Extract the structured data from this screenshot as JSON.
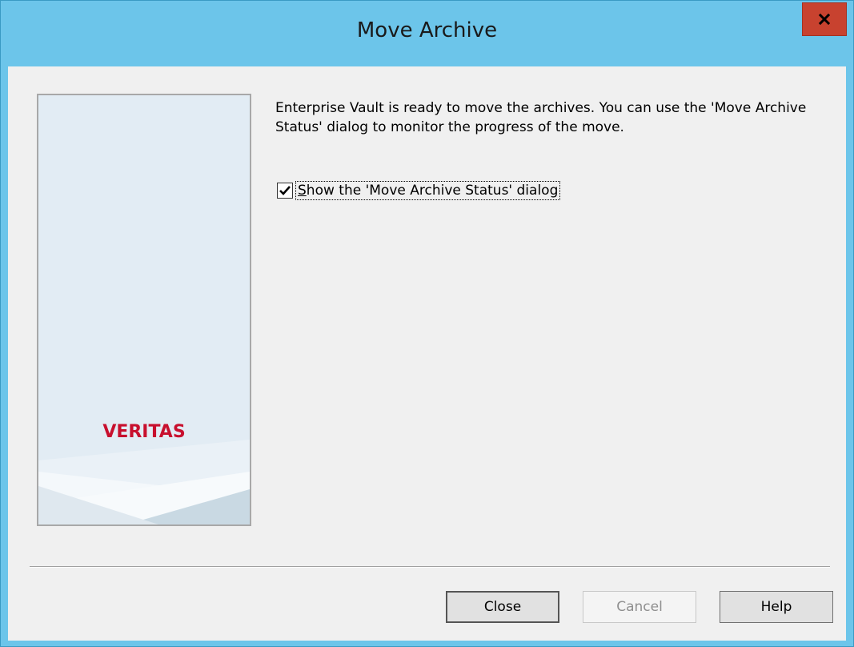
{
  "window": {
    "title": "Move Archive",
    "close_glyph": "x"
  },
  "banner": {
    "logo_text": "VERITAS"
  },
  "message": "Enterprise Vault is ready to move the archives. You can use the 'Move Archive Status' dialog to monitor the progress of the move.",
  "option": {
    "checked": true,
    "label_mnemonic": "S",
    "label_rest": "how the 'Move Archive Status' dialog"
  },
  "buttons": {
    "close": "Close",
    "cancel": "Cancel",
    "help": "Help"
  },
  "colors": {
    "titlebar": "#6cc5ea",
    "close_button": "#c8422f",
    "client_bg": "#f0f0f0",
    "banner_bg": "#e2ecf4",
    "logo_red": "#c8102e"
  }
}
